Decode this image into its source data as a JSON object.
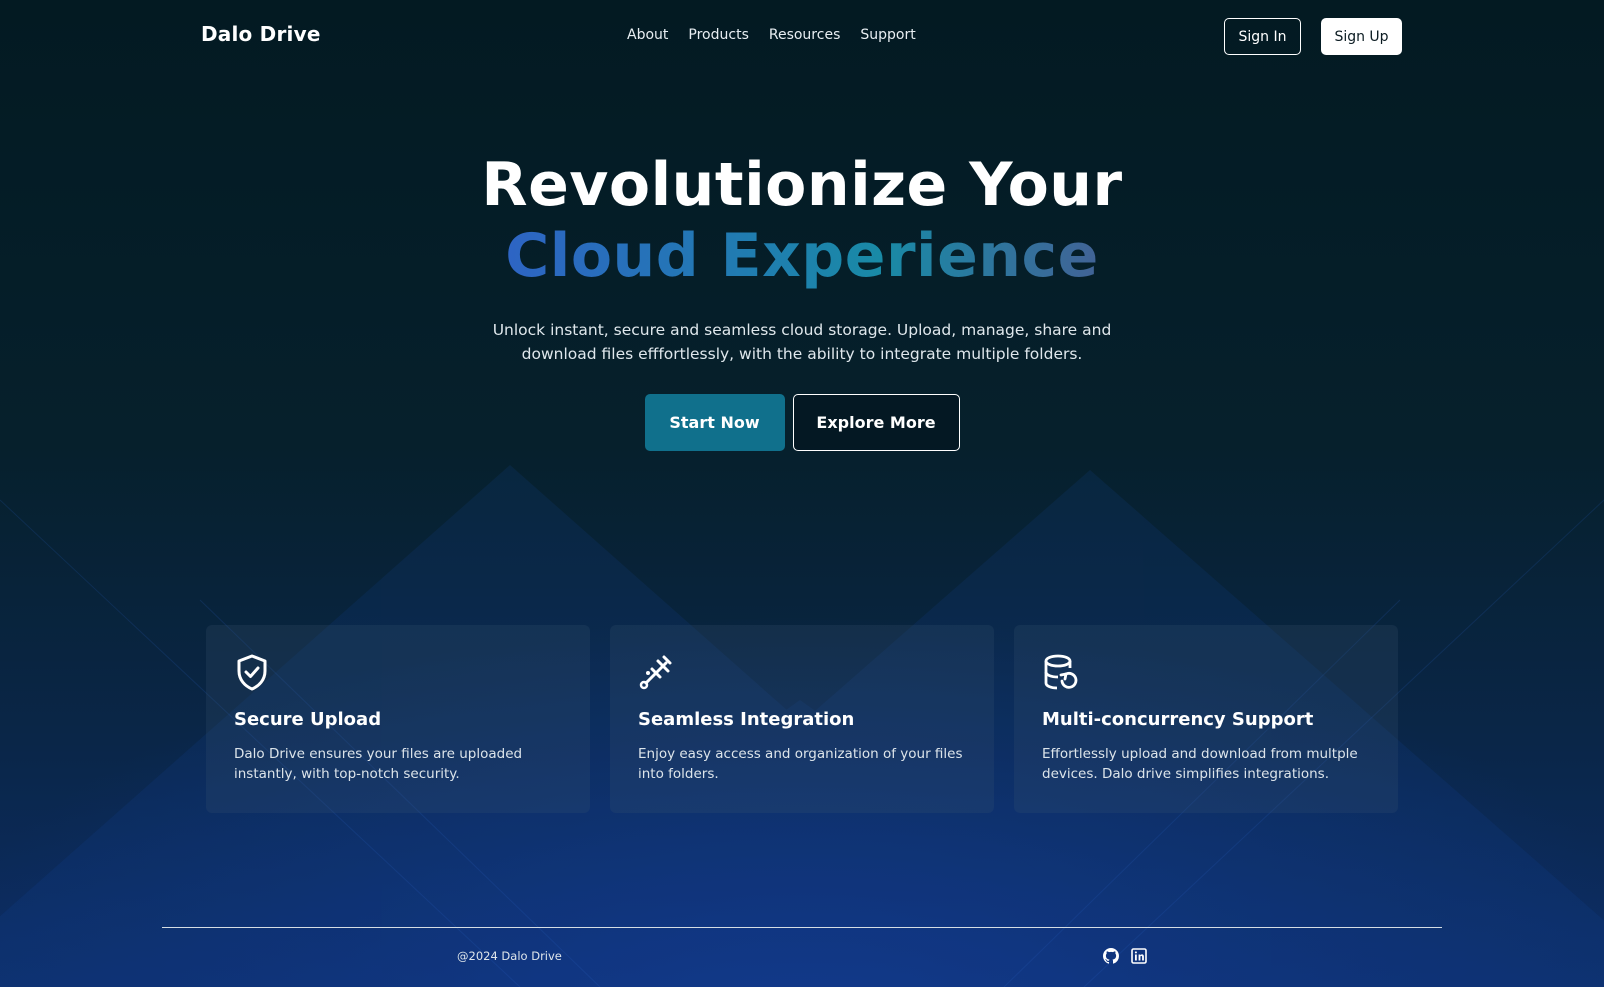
{
  "nav": {
    "brand": "Dalo Drive",
    "links": [
      "About",
      "Products",
      "Resources",
      "Support"
    ],
    "sign_in": "Sign In",
    "sign_up": "Sign Up"
  },
  "hero": {
    "title_line1": "Revolutionize Your",
    "title_line2": "Cloud Experience",
    "description": "Unlock instant, secure and seamless cloud storage. Upload, manage, share and download files efffortlessly, with the ability to integrate multiple folders.",
    "primary_cta": "Start Now",
    "secondary_cta": "Explore More"
  },
  "features": [
    {
      "icon": "shield-check-icon",
      "title": "Secure Upload",
      "text": "Dalo Drive ensures your files are uploaded instantly, with top-notch security."
    },
    {
      "icon": "plug-icon",
      "title": "Seamless Integration",
      "text": "Enjoy easy access and organization of your files into folders."
    },
    {
      "icon": "database-sync-icon",
      "title": "Multi-concurrency Support",
      "text": "Effortlessly upload and download from multple devices. Dalo drive simplifies integrations."
    }
  ],
  "footer": {
    "copyright": "@2024 Dalo Drive",
    "socials": [
      "github-icon",
      "linkedin-icon"
    ]
  },
  "colors": {
    "background": "#041a22",
    "accent": "#10708c",
    "gradient": [
      "#6f2fd0",
      "#2f62c6",
      "#198aa6",
      "#55508e",
      "#c3264f"
    ]
  }
}
